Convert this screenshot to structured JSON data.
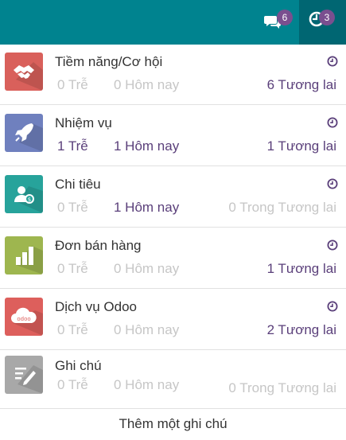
{
  "systray": {
    "messages_count": "6",
    "activities_count": "3"
  },
  "activities": [
    {
      "app": "Tiềm năng/Cơ hội",
      "late": "0 Trễ",
      "today": "0 Hôm nay",
      "future": "6 Tương lai",
      "color": "#d9605b"
    },
    {
      "app": "Nhiệm vụ",
      "late": "1 Trễ",
      "today": "1 Hôm nay",
      "future": "1 Tương lai",
      "color": "#6f80be"
    },
    {
      "app": "Chi tiêu",
      "late": "0 Trễ",
      "today": "1 Hôm nay",
      "future": "0 Trong Tương lai",
      "color": "#27a39b"
    },
    {
      "app": "Đơn bán hàng",
      "late": "0 Trễ",
      "today": "0 Hôm nay",
      "future": "1 Tương lai",
      "color": "#9eb64f"
    },
    {
      "app": "Dịch vụ Odoo",
      "late": "0 Trễ",
      "today": "0 Hôm nay",
      "future": "2 Tương lai",
      "color": "#dd5f5c"
    },
    {
      "app": "Ghi chú",
      "late": "0 Trễ",
      "today": "0 Hôm nay",
      "future": "0 Trong Tương lai",
      "color": "#a8a8a8"
    }
  ],
  "footer": {
    "add_note": "Thêm một ghi chú"
  },
  "colors": {
    "topbar": "#00838f",
    "accent": "#5a3f7a",
    "muted": "#c6c6c6",
    "badge": "#7a4f8f"
  }
}
